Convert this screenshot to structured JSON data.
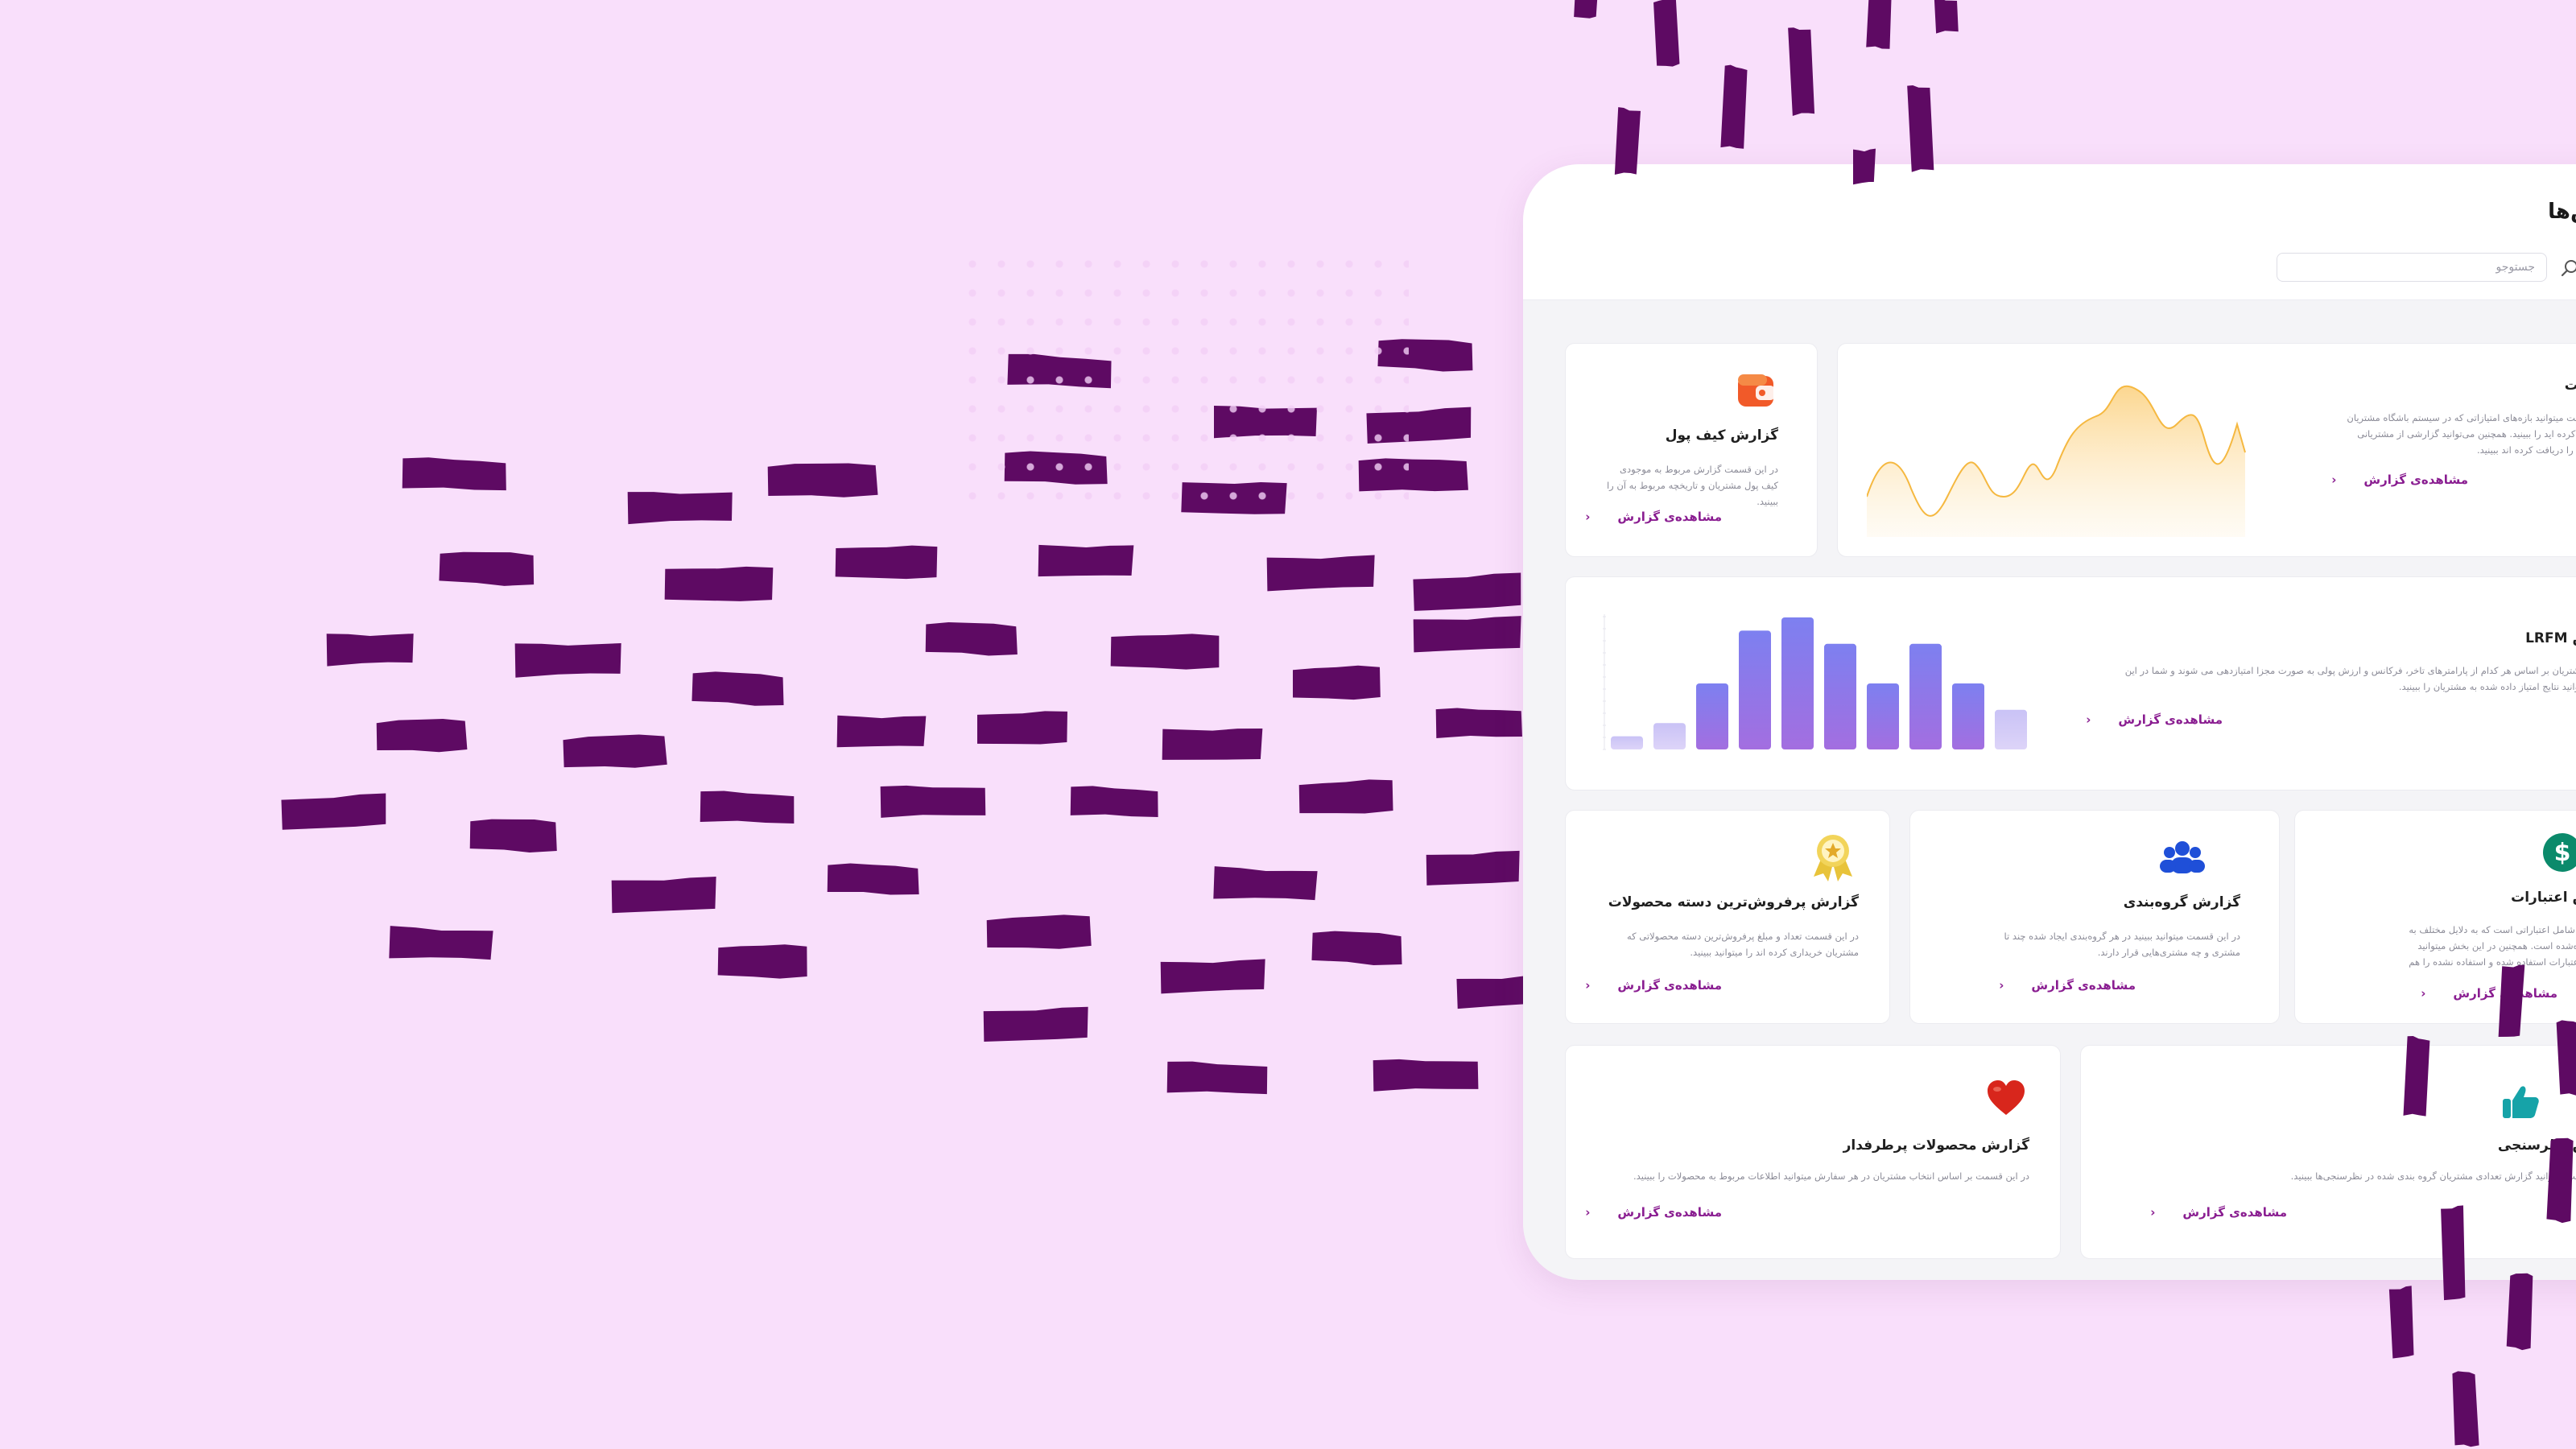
{
  "colors": {
    "background": "#f9dffb",
    "stroke": "#5e0a63",
    "accent": "#8a1e91"
  },
  "panel": {
    "title": "گزارش‌ها",
    "search": {
      "placeholder": "جستوجو",
      "value": ""
    }
  },
  "cards": {
    "points": {
      "title": "امتیازات",
      "desc": "در این قسمت میتوانید بازه‌های امتیازاتی که در سیستم باشگاه مشتریان خود تعریف کرده اید را ببینید. همچنین می‌توانید گزارشی از مشتریانی که امتیازات را دریافت کرده اند ببینید.",
      "link": "مشاهده‌ی گزارش",
      "icon": "area-chart-icon"
    },
    "wallet": {
      "title": "گزارش کیف پول",
      "desc": "در این قسمت گزارش مربوط به موجودی کیف پول مشتریان و تاریخچه مربوط به آن را ببینید.",
      "link": "مشاهده‌ی گزارش",
      "icon": "wallet-icon"
    },
    "lrfm": {
      "title": "گزارش LRFM",
      "desc": "در روش مشتریان بر اساس هر کدام از پارامترهای تاخر، فرکانس و ارزش پولی به صورت مجزا امتیازدهی می شوند و شما در این قسمت میتوانید نتایج امتیاز داده شده به مشتریان را ببینید.",
      "link": "مشاهده‌ی گزارش",
      "icon": "bar-chart-icon",
      "bars": [
        0.1,
        0.2,
        0.5,
        0.9,
        1.0,
        0.8,
        0.5,
        0.8,
        0.5,
        0.3
      ]
    },
    "credits": {
      "title": "گزارش اعتبارات",
      "desc": "این قسمت شامل اعتباراتی است که به دلایل مختلف به مشتری داده‌شده است. همچنین در این بخش میتوانید مقدار کل اعتبارات استفاده شده و استفاده نشده را هم ببینید.",
      "link": "مشاهده‌ی گزارش",
      "icon": "dollar-icon"
    },
    "grouping": {
      "title": "گزارش گروه‌بندی",
      "desc": "در این قسمت میتوانید ببینید در هر گروه‌بندی ایجاد شده چند تا مشتری و چه مشتری‌هایی قرار دارند.",
      "link": "مشاهده‌ی گزارش",
      "icon": "users-group-icon"
    },
    "bestseller": {
      "title": "گزارش پرفروش‌ترین دسته محصولات",
      "desc": "در این قسمت تعداد و مبلغ پرفروش‌ترین دسته محصولاتی که مشتریان خریداری کرده اند را میتوانید ببینید.",
      "link": "مشاهده‌ی گزارش",
      "icon": "award-medal-icon"
    },
    "survey": {
      "title": "گزارش نظرسنجی",
      "desc": "در این قسمت میتوانید گزارش تعدادی مشتریان گروه بندی شده در نظرسنجی‌ها ببینید.",
      "link": "مشاهده‌ی گزارش",
      "icon": "thumbs-up-icon"
    },
    "popular": {
      "title": "گزارش محصولات پرطرفدار",
      "desc": "در این قسمت بر اساس انتخاب مشتریان در هر سفارش میتوانید اطلاعات مربوط به محصولات را ببینید.",
      "link": "مشاهده‌ی گزارش",
      "icon": "heart-icon"
    }
  }
}
